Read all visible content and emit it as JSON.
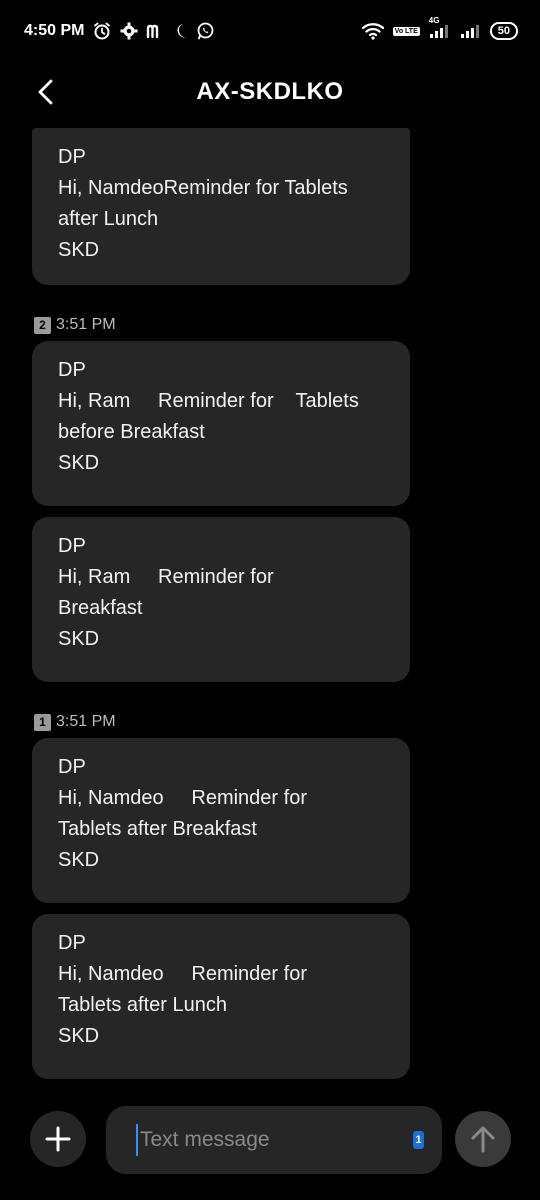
{
  "status_bar": {
    "time": "4:50 PM",
    "icons": [
      "alarm-icon",
      "settings-icon",
      "m-app-icon",
      "night-mode-icon",
      "whatsapp-icon"
    ],
    "right_icons": [
      "wifi-icon",
      "volte-icon",
      "signal-4g-icon",
      "signal-icon"
    ],
    "volte_label": "Vo LTE",
    "network_label": "4G",
    "battery": "50"
  },
  "header": {
    "title": "AX-SKDLKO"
  },
  "thread": {
    "messages": [
      {
        "lines": [
          "DP",
          "Hi, NamdeoReminder for Tablets",
          "after Lunch",
          "SKD"
        ]
      },
      {
        "lines": [
          "DP",
          "Hi, Ram     Reminder for    Tablets",
          "before Breakfast",
          "SKD"
        ]
      },
      {
        "lines": [
          "DP",
          "Hi, Ram     Reminder for",
          "Breakfast",
          "SKD"
        ]
      },
      {
        "lines": [
          "DP",
          "Hi, Namdeo     Reminder for",
          "Tablets after Breakfast",
          "SKD"
        ]
      },
      {
        "lines": [
          "DP",
          "Hi, Namdeo     Reminder for",
          "Tablets after Lunch",
          "SKD"
        ]
      }
    ],
    "timestamps": [
      {
        "sim": "2",
        "time": "3:51 PM"
      },
      {
        "sim": "1",
        "time": "3:51 PM"
      }
    ]
  },
  "composer": {
    "placeholder": "Text message",
    "sim_badge": "1"
  },
  "colors": {
    "background": "#000000",
    "bubble": "#262626",
    "accent": "#1f6ed6"
  }
}
